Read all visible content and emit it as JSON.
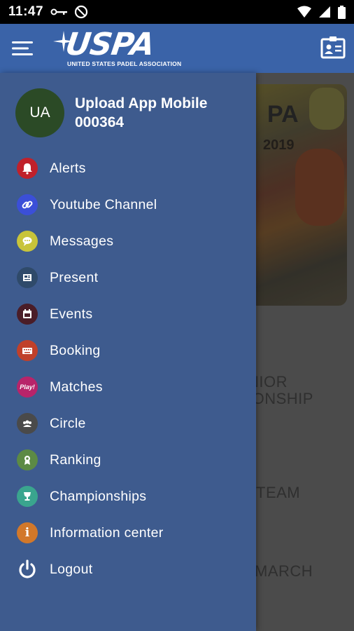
{
  "status_bar": {
    "time": "11:47"
  },
  "app_bar": {
    "logo_text": "USPA",
    "logo_tagline": "UNITED STATES PADEL ASSOCIATION"
  },
  "profile": {
    "initials": "UA",
    "name_line1": "Upload App Mobile",
    "name_line2": "000364"
  },
  "menu": [
    {
      "label": "Alerts",
      "icon": "bell-icon",
      "color": "#c0212b"
    },
    {
      "label": "Youtube Channel",
      "icon": "link-icon",
      "color": "#3b4fd8"
    },
    {
      "label": "Messages",
      "icon": "chat-icon",
      "color": "#c8c43a"
    },
    {
      "label": "Present",
      "icon": "newspaper-icon",
      "color": "#2f4a6a"
    },
    {
      "label": "Events",
      "icon": "calendar-icon",
      "color": "#4a1d28"
    },
    {
      "label": "Booking",
      "icon": "keyboard-icon",
      "color": "#c0402a"
    },
    {
      "label": "Matches",
      "icon": "play-badge-icon",
      "color": "#b8246a"
    },
    {
      "label": "Circle",
      "icon": "group-icon",
      "color": "#4a4a4a"
    },
    {
      "label": "Ranking",
      "icon": "medal-icon",
      "color": "#5c8a44"
    },
    {
      "label": "Championships",
      "icon": "trophy-icon",
      "color": "#3aa58e"
    },
    {
      "label": "Information center",
      "icon": "info-icon",
      "color": "#d2782a"
    },
    {
      "label": "Logout",
      "icon": "power-icon",
      "color": "transparent"
    }
  ],
  "background": {
    "poster_title": "PA",
    "poster_year": "2019",
    "texts": [
      "NIOR",
      "IONSHIP",
      "TEAM",
      "MARCH"
    ]
  }
}
